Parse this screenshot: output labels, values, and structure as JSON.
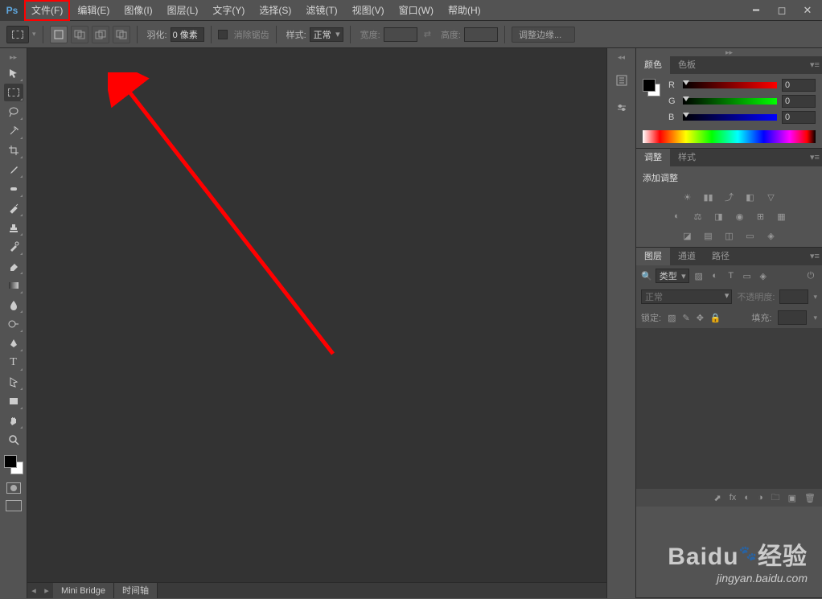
{
  "app": {
    "logo": "Ps"
  },
  "menu": [
    {
      "label": "文件(F)",
      "hl": true
    },
    {
      "label": "编辑(E)"
    },
    {
      "label": "图像(I)"
    },
    {
      "label": "图层(L)"
    },
    {
      "label": "文字(Y)"
    },
    {
      "label": "选择(S)"
    },
    {
      "label": "滤镜(T)"
    },
    {
      "label": "视图(V)"
    },
    {
      "label": "窗口(W)"
    },
    {
      "label": "帮助(H)"
    }
  ],
  "options": {
    "feather_label": "羽化:",
    "feather_value": "0 像素",
    "antialias_label": "消除锯齿",
    "style_label": "样式:",
    "style_value": "正常",
    "width_label": "宽度:",
    "height_label": "高度:",
    "refine_edge": "调整边缘..."
  },
  "bottom_tabs": [
    "Mini Bridge",
    "时间轴"
  ],
  "color_panel": {
    "tabs": [
      "颜色",
      "色板"
    ],
    "channels": [
      {
        "label": "R",
        "value": "0"
      },
      {
        "label": "G",
        "value": "0"
      },
      {
        "label": "B",
        "value": "0"
      }
    ]
  },
  "adjust_panel": {
    "tabs": [
      "调整",
      "样式"
    ],
    "title": "添加调整"
  },
  "layer_panel": {
    "tabs": [
      "图层",
      "通道",
      "路径"
    ],
    "kind": "类型",
    "mode": "正常",
    "opacity_label": "不透明度:",
    "lock_label": "锁定:",
    "fill_label": "填充:"
  },
  "watermark": {
    "big": "Baidu",
    "cn": "经验",
    "url": "jingyan.baidu.com"
  }
}
